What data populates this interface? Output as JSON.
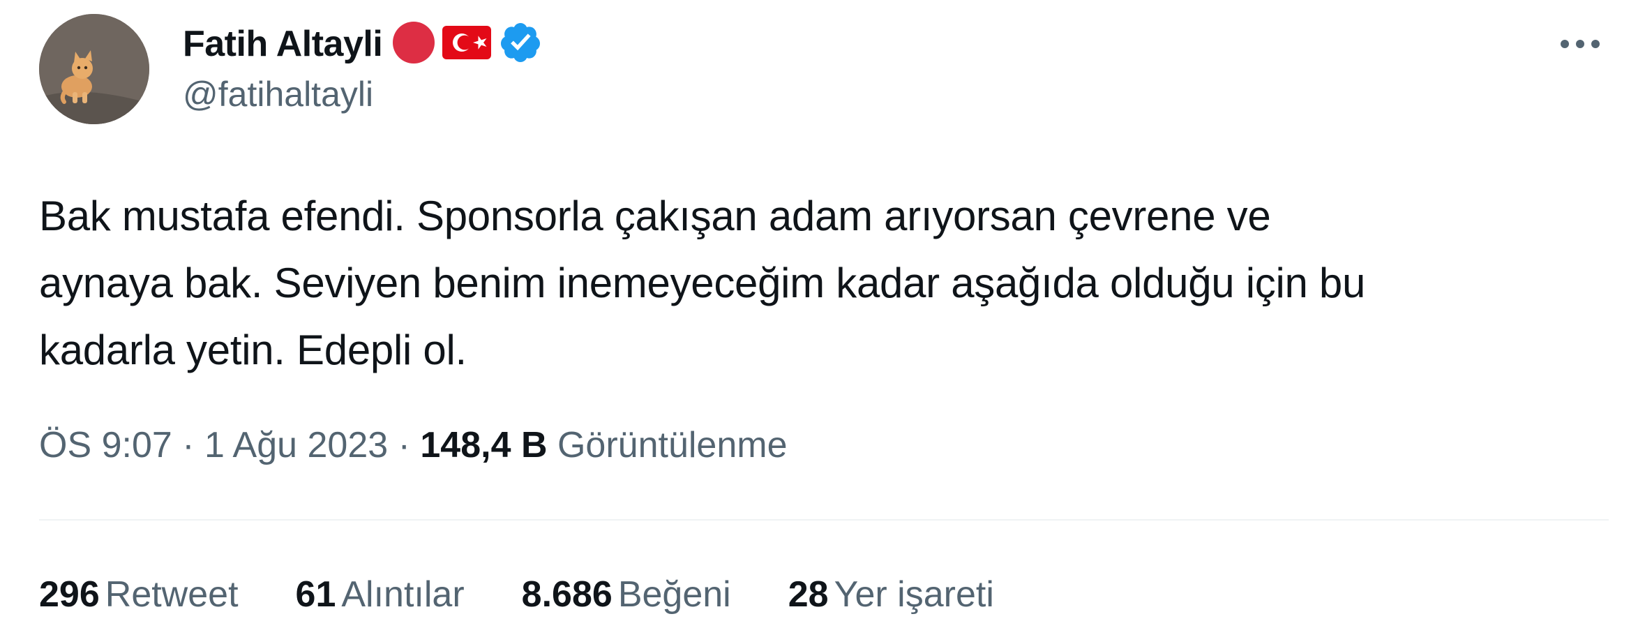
{
  "author": {
    "display_name": "Fatih Altayli",
    "handle": "@fatihaltayli",
    "badges": {
      "red_circle_color": "#dd2e44",
      "flag": "Turkey flag",
      "verified_color": "#1d9bf0"
    }
  },
  "tweet": {
    "text": "Bak mustafa efendi. Sponsorla çakışan adam arıyorsan çevrene ve\naynaya bak. Seviyen benim inemeyeceğim kadar aşağıda olduğu için bu\nkadarla yetin. Edepli ol."
  },
  "meta": {
    "time": "ÖS 9:07",
    "date": "1 Ağu 2023",
    "separator": " · ",
    "views_count": "148,4 B",
    "views_label": "Görüntülenme"
  },
  "stats": [
    {
      "count": "296",
      "label": "Retweet"
    },
    {
      "count": "61",
      "label": "Alıntılar"
    },
    {
      "count": "8.686",
      "label": "Beğeni"
    },
    {
      "count": "28",
      "label": "Yer işareti"
    }
  ],
  "icons": {
    "more": "more-options-icon",
    "verified": "verified-badge-icon"
  }
}
